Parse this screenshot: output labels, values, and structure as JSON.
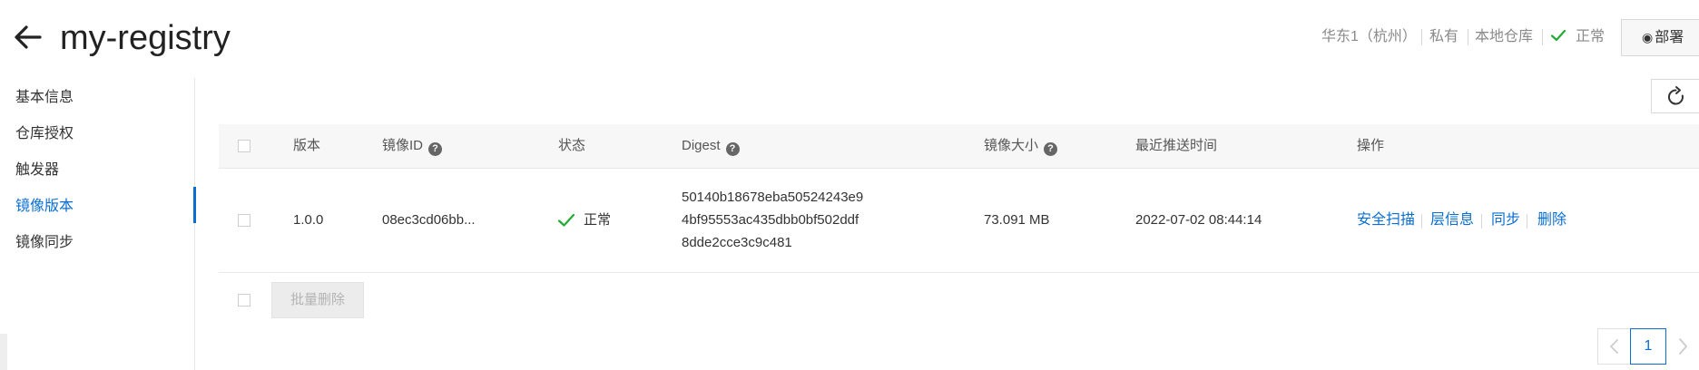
{
  "header": {
    "title": "my-registry",
    "region": "华东1（杭州）",
    "visibility": "私有",
    "repo_type": "本地仓库",
    "status": "正常",
    "deploy_label": "部署",
    "deploy_icon": "cube-icon",
    "back_icon": "arrow-left-icon"
  },
  "sidebar": {
    "items": [
      {
        "label": "基本信息",
        "active": false
      },
      {
        "label": "仓库授权",
        "active": false
      },
      {
        "label": "触发器",
        "active": false
      },
      {
        "label": "镜像版本",
        "active": true
      },
      {
        "label": "镜像同步",
        "active": false
      }
    ]
  },
  "table": {
    "columns": {
      "version": "版本",
      "image_id": "镜像ID",
      "status": "状态",
      "digest": "Digest",
      "size": "镜像大小",
      "pushed": "最近推送时间",
      "actions": "操作"
    },
    "rows": [
      {
        "version": "1.0.0",
        "image_id": "08ec3cd06bb...",
        "status": "正常",
        "digest_lines": [
          "50140b18678eba50524243e9",
          "4bf95553ac435dbb0bf502ddf",
          "8dde2cce3c9c481"
        ],
        "size": "73.091 MB",
        "pushed": "2022-07-02 08:44:14",
        "actions": [
          "安全扫描",
          "层信息",
          "同步",
          "删除"
        ]
      }
    ],
    "batch_delete_label": "批量删除"
  },
  "pagination": {
    "current_page": "1"
  },
  "colors": {
    "accent": "#0a6ed1",
    "success": "#22aa33",
    "header_bg": "#f7f7f7"
  }
}
